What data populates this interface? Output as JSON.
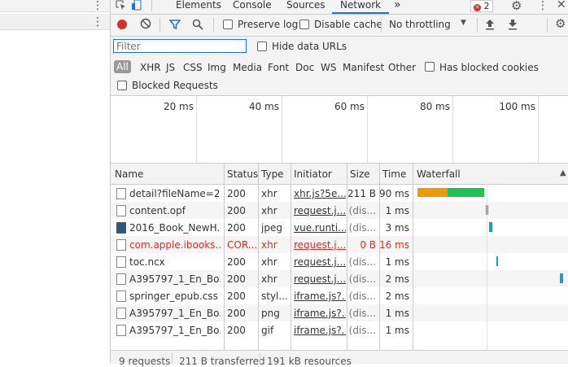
{
  "tabs": [
    {
      "label": "Elements"
    },
    {
      "label": "Console"
    },
    {
      "label": "Sources"
    },
    {
      "label": "Network"
    }
  ],
  "more_tabs_glyph": "»",
  "error_count": "2",
  "toolbar": {
    "preserve_log": "Preserve log",
    "disable_cache": "Disable cache",
    "throttling": "No throttling"
  },
  "filter": {
    "placeholder": "Filter",
    "hide_data_urls": "Hide data URLs",
    "types": [
      "All",
      "XHR",
      "JS",
      "CSS",
      "Img",
      "Media",
      "Font",
      "Doc",
      "WS",
      "Manifest",
      "Other"
    ],
    "has_blocked_cookies": "Has blocked cookies",
    "blocked_requests": "Blocked Requests"
  },
  "overview": {
    "ticks": [
      "20 ms",
      "40 ms",
      "60 ms",
      "80 ms",
      "100 ms"
    ]
  },
  "columns": {
    "name": "Name",
    "status": "Status",
    "type": "Type",
    "initiator": "Initiator",
    "size": "Size",
    "time": "Time",
    "waterfall": "Waterfall"
  },
  "rows": [
    {
      "name": "detail?fileName=2...",
      "status": "200",
      "type": "xhr",
      "initiator": "xhr.js?5e...",
      "size": "211 B",
      "time": "90 ms",
      "error": false
    },
    {
      "name": "content.opf",
      "status": "200",
      "type": "xhr",
      "initiator": "request.j...",
      "size": "(dis...",
      "time": "1 ms",
      "error": false
    },
    {
      "name": "2016_Book_NewH...",
      "status": "200",
      "type": "jpeg",
      "initiator": "vue.runti...",
      "size": "(dis...",
      "time": "3 ms",
      "error": false
    },
    {
      "name": "com.apple.ibooks....",
      "status": "COR...",
      "type": "xhr",
      "initiator": "request.j...",
      "size": "0 B",
      "time": "16 ms",
      "error": true
    },
    {
      "name": "toc.ncx",
      "status": "200",
      "type": "xhr",
      "initiator": "request.j...",
      "size": "(dis...",
      "time": "1 ms",
      "error": false
    },
    {
      "name": "A395797_1_En_Bo...",
      "status": "200",
      "type": "xhr",
      "initiator": "request.j...",
      "size": "(dis...",
      "time": "2 ms",
      "error": false
    },
    {
      "name": "springer_epub.css",
      "status": "200",
      "type": "styl...",
      "initiator": "iframe.js?...",
      "size": "(dis...",
      "time": "2 ms",
      "error": false
    },
    {
      "name": "A395797_1_En_Bo...",
      "status": "200",
      "type": "png",
      "initiator": "iframe.js?...",
      "size": "(dis...",
      "time": "1 ms",
      "error": false
    },
    {
      "name": "A395797_1_En_Bo...",
      "status": "200",
      "type": "gif",
      "initiator": "iframe.js?...",
      "size": "(dis...",
      "time": "1 ms",
      "error": false
    }
  ],
  "footer": {
    "requests": "9 requests",
    "transferred": "211 B transferred",
    "resources": "191 kB resources"
  },
  "colors": {
    "accent": "#1a73e8",
    "record": "#d93025",
    "waiting": "#f29900",
    "download": "#1bc454",
    "bar": "#1a9bd7"
  }
}
